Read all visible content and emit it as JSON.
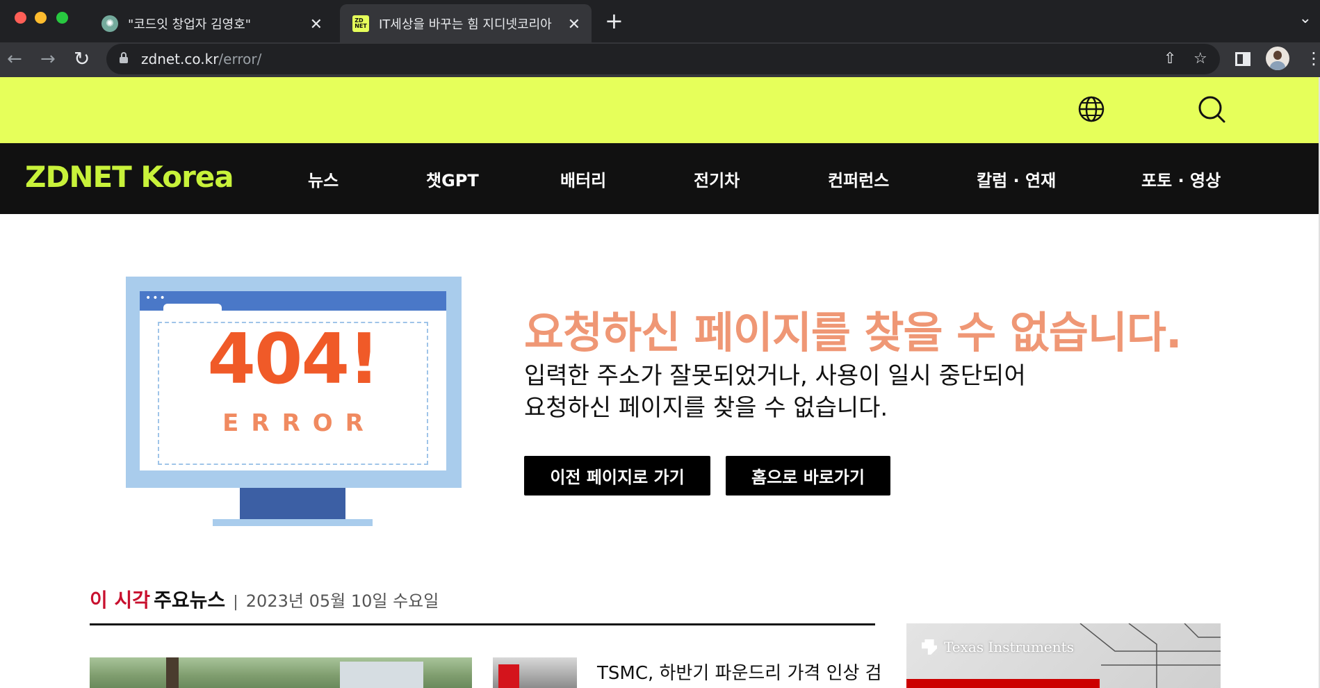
{
  "browser": {
    "tabs": [
      {
        "title": "\"코드잇 창업자 김영호\"",
        "icon": "chatgpt-icon",
        "active": false
      },
      {
        "title": "IT세상을 바꾸는 힘 지디넷코리아",
        "icon": "zdnet-icon",
        "active": true
      }
    ],
    "zdnet_favicon_text": "ZD\nNET",
    "new_tab_glyph": "+",
    "close_glyph": "✕",
    "url_host": "zdnet.co.kr",
    "url_path": "/error/"
  },
  "site": {
    "logo": "ZDNET Korea",
    "accent_color": "#e6ff5a",
    "nav": [
      "뉴스",
      "챗GPT",
      "배터리",
      "전기차",
      "컨퍼런스",
      "칼럼 · 연재",
      "포토 · 영상"
    ]
  },
  "error": {
    "code": "404!",
    "word": "ERROR",
    "title": "요청하신 페이지를 찾을 수 없습니다.",
    "desc_line1": "입력한 주소가 잘못되었거나, 사용이 일시 중단되어",
    "desc_line2": "요청하신 페이지를 찾을 수 없습니다.",
    "btn_prev": "이전 페이지로 가기",
    "btn_home": "홈으로 바로가기"
  },
  "news": {
    "header_red": "이 시각",
    "header_black": "주요뉴스",
    "separator": "|",
    "date": "2023년 05월 10일 수요일",
    "headline": "TSMC, 하반기 파운드리 가격 인상 검"
  },
  "ad": {
    "brand": "Texas Instruments"
  }
}
